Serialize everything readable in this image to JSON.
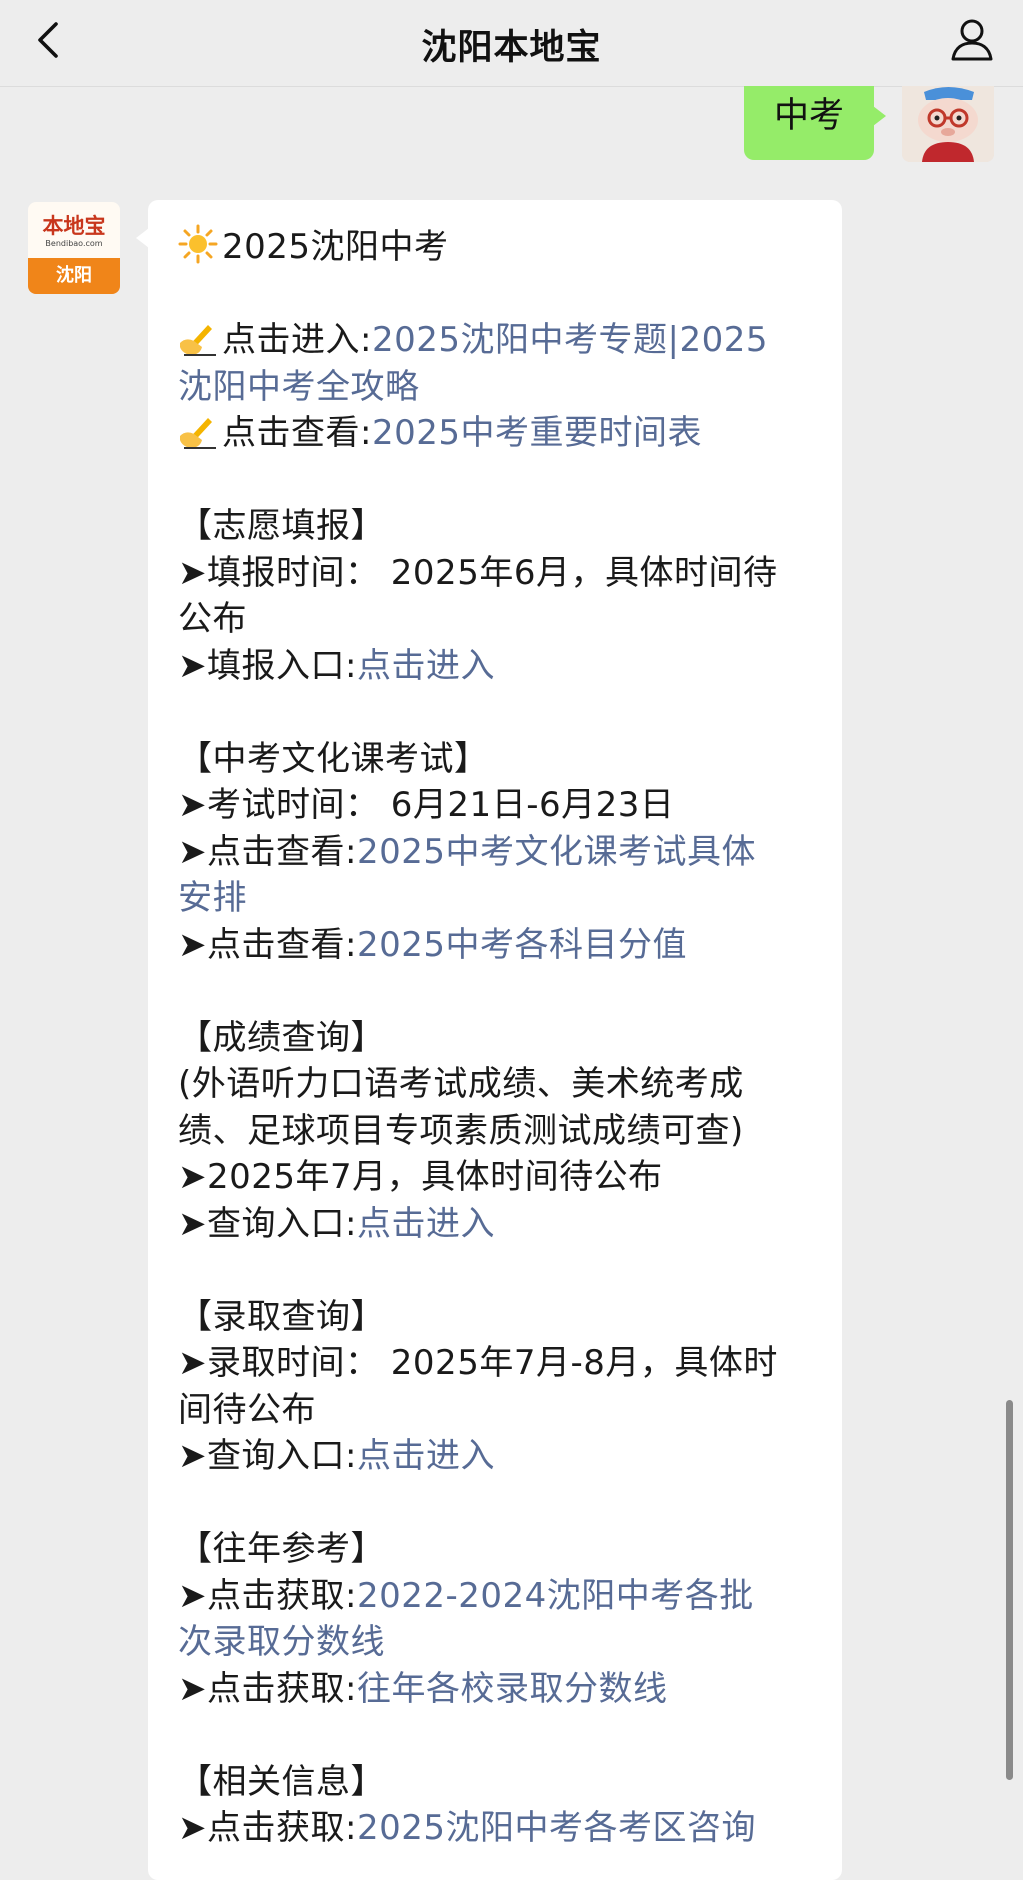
{
  "header": {
    "title": "沈阳本地宝"
  },
  "chat": {
    "user_message": "中考",
    "bot_logo": {
      "main": "本地宝",
      "sub": "Bendibao.com",
      "city": "沈阳"
    },
    "article": {
      "title": "2025沈阳中考",
      "entry": {
        "prefix": "点击进入:",
        "link1_a": "2025沈阳中考专题|2025",
        "link1_b": "沈阳中考全攻略"
      },
      "view": {
        "prefix": "点击查看:",
        "link": "2025中考重要时间表"
      },
      "sections": {
        "volunteer": {
          "heading": "【志愿填报】",
          "time_line_a": "➤填报时间： 2025年6月，具体时间待",
          "time_line_b": "公布",
          "entry_prefix": "➤填报入口:",
          "entry_link": "点击进入"
        },
        "exam": {
          "heading": "【中考文化课考试】",
          "time_line": "➤考试时间： 6月21日-6月23日",
          "view1_prefix": "➤点击查看:",
          "view1_link_a": "2025中考文化课考试具体",
          "view1_link_b": "安排",
          "view2_prefix": "➤点击查看:",
          "view2_link": "2025中考各科目分值"
        },
        "score": {
          "heading": "【成绩查询】",
          "note_a": "(外语听力口语考试成绩、美术统考成",
          "note_b": "绩、足球项目专项素质测试成绩可查)",
          "time_line": "➤2025年7月，具体时间待公布",
          "entry_prefix": "➤查询入口:",
          "entry_link": "点击进入"
        },
        "admission": {
          "heading": "【录取查询】",
          "time_line_a": "➤录取时间： 2025年7月-8月，具体时",
          "time_line_b": "间待公布",
          "entry_prefix": "➤查询入口:",
          "entry_link": "点击进入"
        },
        "history": {
          "heading": "【往年参考】",
          "get1_prefix": "➤点击获取:",
          "get1_link_a": "2022-2024沈阳中考各批",
          "get1_link_b": "次录取分数线",
          "get2_prefix": "➤点击获取:",
          "get2_link": "往年各校录取分数线"
        },
        "related": {
          "heading": "【相关信息】",
          "get1_prefix": "➤点击获取:",
          "get1_link": "2025沈阳中考各考区咨询"
        }
      }
    }
  },
  "colors": {
    "background": "#ededed",
    "user_bubble": "#95ec69",
    "link": "#576b95",
    "logo_orange": "#f08519",
    "logo_red": "#c8361c"
  },
  "icons": [
    "chevron-left-icon",
    "person-icon",
    "sun-icon",
    "writing-hand-icon"
  ]
}
